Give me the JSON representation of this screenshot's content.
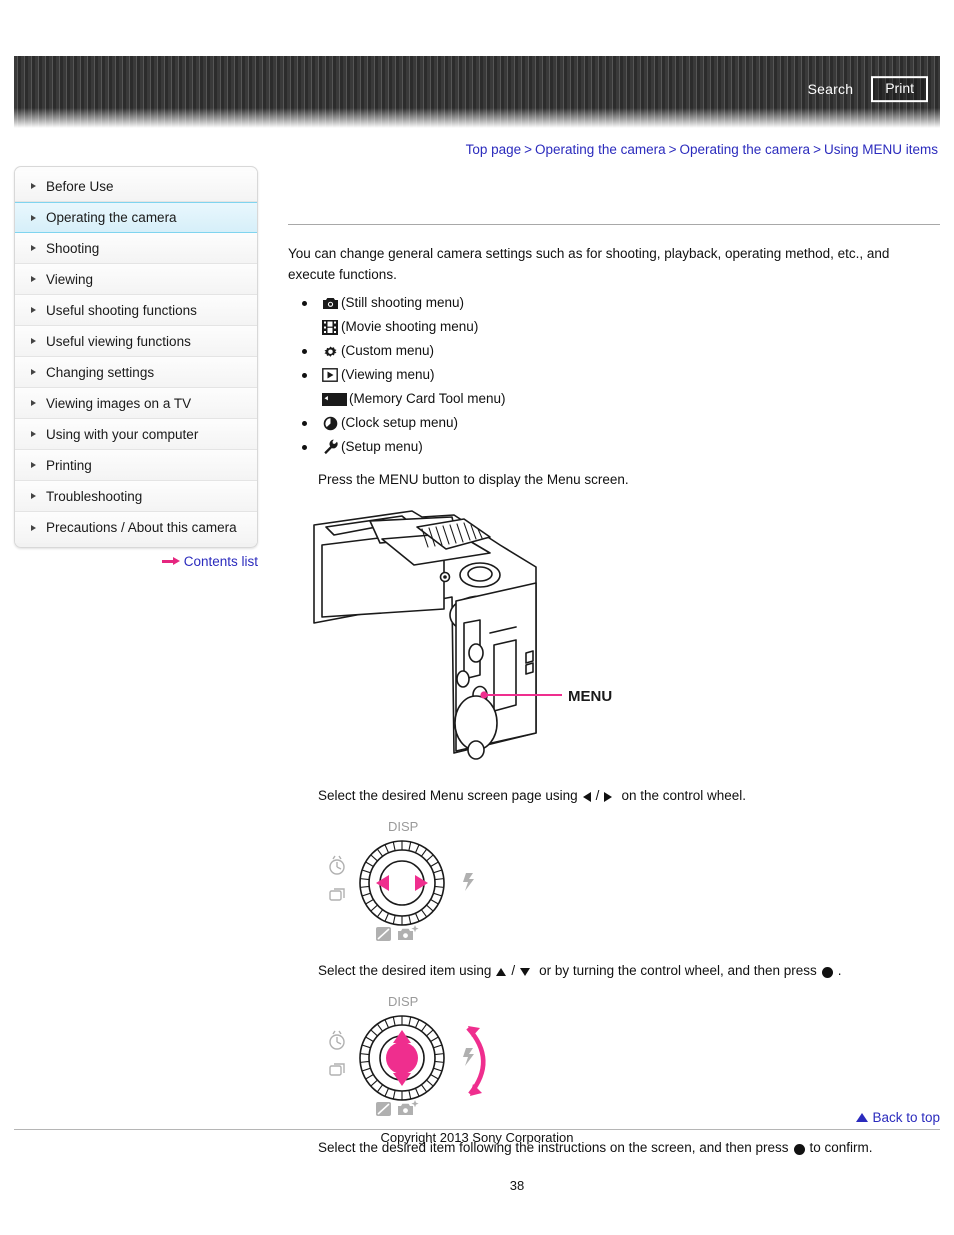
{
  "header": {
    "search_label": "Search",
    "print_label": "Print"
  },
  "breadcrumb": {
    "separator": ">",
    "items": [
      {
        "label": "Top page"
      },
      {
        "label": "Operating the camera"
      },
      {
        "label": "Operating the camera"
      },
      {
        "label": "Using MENU items"
      }
    ]
  },
  "sidebar": {
    "items": [
      {
        "label": "Before Use",
        "active": false
      },
      {
        "label": "Operating the camera",
        "active": true
      },
      {
        "label": "Shooting",
        "active": false
      },
      {
        "label": "Viewing",
        "active": false
      },
      {
        "label": "Useful shooting functions",
        "active": false
      },
      {
        "label": "Useful viewing functions",
        "active": false
      },
      {
        "label": "Changing settings",
        "active": false
      },
      {
        "label": "Viewing images on a TV",
        "active": false
      },
      {
        "label": "Using with your computer",
        "active": false
      },
      {
        "label": "Printing",
        "active": false
      },
      {
        "label": "Troubleshooting",
        "active": false
      },
      {
        "label": "Precautions / About this camera",
        "active": false
      }
    ],
    "contents_list_label": "Contents list"
  },
  "main": {
    "intro": "You can change general camera settings such as for shooting, playback, operating method, etc., and execute functions.",
    "menu_items": [
      {
        "icon": "still-camera-icon",
        "label": "(Still shooting menu)"
      },
      {
        "icon": "movie-film-icon",
        "label": "(Movie shooting menu)"
      },
      {
        "icon": "gear-icon",
        "label": "(Custom menu)"
      },
      {
        "icon": "play-triangle-icon",
        "label": "(Viewing menu)"
      },
      {
        "icon": "memory-card-icon",
        "label": "(Memory Card Tool menu)"
      },
      {
        "icon": "clock-icon",
        "label": "(Clock setup menu)"
      },
      {
        "icon": "wrench-icon",
        "label": "(Setup menu)"
      }
    ],
    "step1": "Press the MENU button to display the Menu screen.",
    "step2": {
      "before": "Select the desired Menu screen page using",
      "between": "/",
      "after": "on the control wheel."
    },
    "step3": {
      "before": "Select the desired item using",
      "between": "/",
      "middle": "or by turning the control wheel, and then press",
      "after": "."
    },
    "step4": {
      "before": "Select the desired item following the instructions on the screen, and then press",
      "after": "to confirm."
    },
    "camera_callout_label": "MENU",
    "wheel_labels": {
      "top": "DISP",
      "left_upper": "self-timer-icon",
      "left_lower": "burst-drive-icon",
      "right": "flash-icon",
      "bottom_left": "exposure-compensation-icon",
      "bottom_right": "photo-creativity-icon"
    }
  },
  "footer": {
    "back_to_top_label": "Back to top",
    "copyright": "Copyright 2013 Sony Corporation",
    "page_number": "38"
  },
  "colors": {
    "link": "#2b2bbd",
    "accent_pink": "#ef2e8e",
    "highlight_bg": "#d6eff9",
    "highlight_border": "#7fd4ef"
  }
}
